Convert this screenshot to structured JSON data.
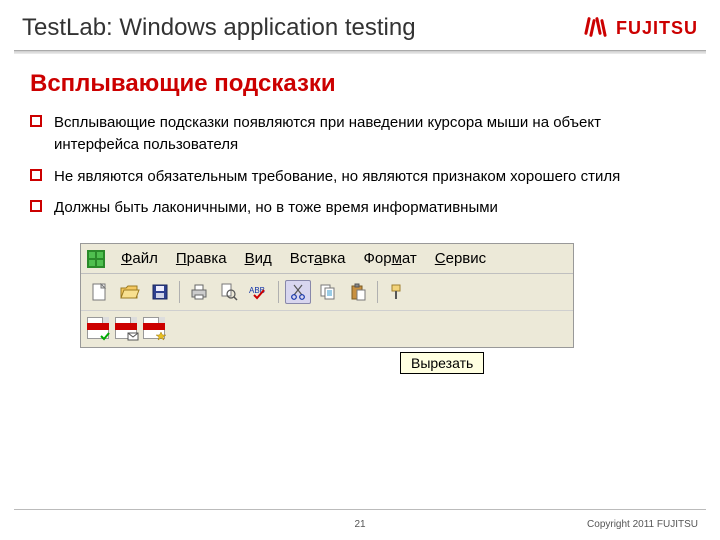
{
  "header": {
    "title": "TestLab: Windows application testing",
    "brand": "FUJITSU"
  },
  "section_title": "Всплывающие подсказки",
  "bullets": [
    "Всплывающие подсказки появляются при наведении курсора мыши на объект интерфейса пользователя",
    "Не являются обязательным требование, но являются признаком хорошего стиля",
    "Должны быть лаконичными, но в тоже время информативными"
  ],
  "excel": {
    "menu": {
      "file": {
        "u": "Ф",
        "rest": "айл"
      },
      "edit": {
        "u": "П",
        "rest": "равка"
      },
      "view": {
        "u": "В",
        "rest": "ид"
      },
      "insert": {
        "u": "",
        "rest": "Вст",
        "u2": "а",
        "rest2": "вка"
      },
      "format": {
        "u": "",
        "rest": "Фор",
        "u2": "м",
        "rest2": "ат"
      },
      "tools": {
        "u": "С",
        "rest": "ервис"
      }
    },
    "tooltip": "Вырезать"
  },
  "footer": {
    "page": "21",
    "copyright": "Copyright 2011 FUJITSU"
  }
}
